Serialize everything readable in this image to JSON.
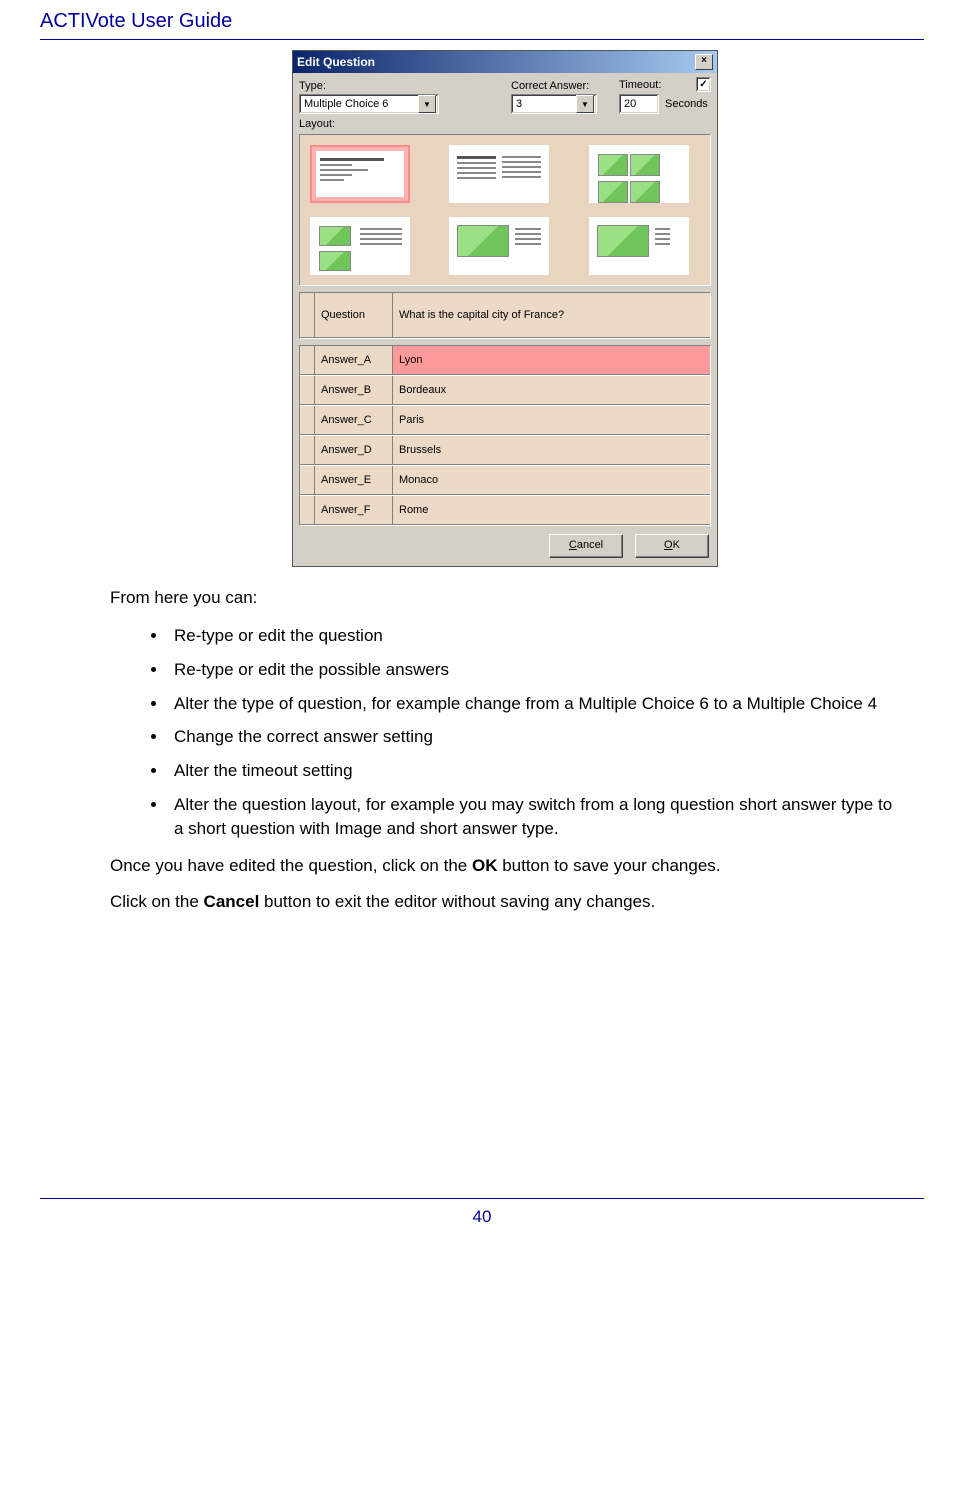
{
  "header": {
    "title": "ACTIVote User Guide"
  },
  "dialog": {
    "title": "Edit Question",
    "labels": {
      "type": "Type:",
      "correct": "Correct Answer:",
      "timeout": "Timeout:",
      "seconds": "Seconds",
      "layout": "Layout:"
    },
    "type_value": "Multiple Choice 6",
    "correct_value": "3",
    "timeout_value": "20",
    "timeout_checked": "✓",
    "question_label": "Question",
    "question_value": "What is the capital city of France?",
    "answers": [
      {
        "label": "Answer_A",
        "value": "Lyon",
        "hl": true
      },
      {
        "label": "Answer_B",
        "value": "Bordeaux",
        "hl": false
      },
      {
        "label": "Answer_C",
        "value": "Paris",
        "hl": false
      },
      {
        "label": "Answer_D",
        "value": "Brussels",
        "hl": false
      },
      {
        "label": "Answer_E",
        "value": "Monaco",
        "hl": false
      },
      {
        "label": "Answer_F",
        "value": "Rome",
        "hl": false
      }
    ],
    "buttons": {
      "cancel_u": "C",
      "cancel_rest": "ancel",
      "ok_u": "O",
      "ok_rest": "K"
    }
  },
  "body": {
    "intro": "From here you can:",
    "bullets": [
      "Re-type or edit the question",
      "Re-type or edit the possible answers",
      "Alter the type of question, for example change from a Multiple Choice 6 to a Multiple Choice 4",
      "Change the correct answer setting",
      "Alter the timeout setting",
      "Alter the question layout, for example you may switch from a long question short answer type to a short question with Image and short answer type."
    ],
    "p1a": "Once you have edited the question, click on the ",
    "p1b": "OK",
    "p1c": " button to save your changes.",
    "p2a": "Click on the ",
    "p2b": "Cancel",
    "p2c": " button to exit the editor without saving any changes."
  },
  "footer": {
    "page": "40"
  }
}
